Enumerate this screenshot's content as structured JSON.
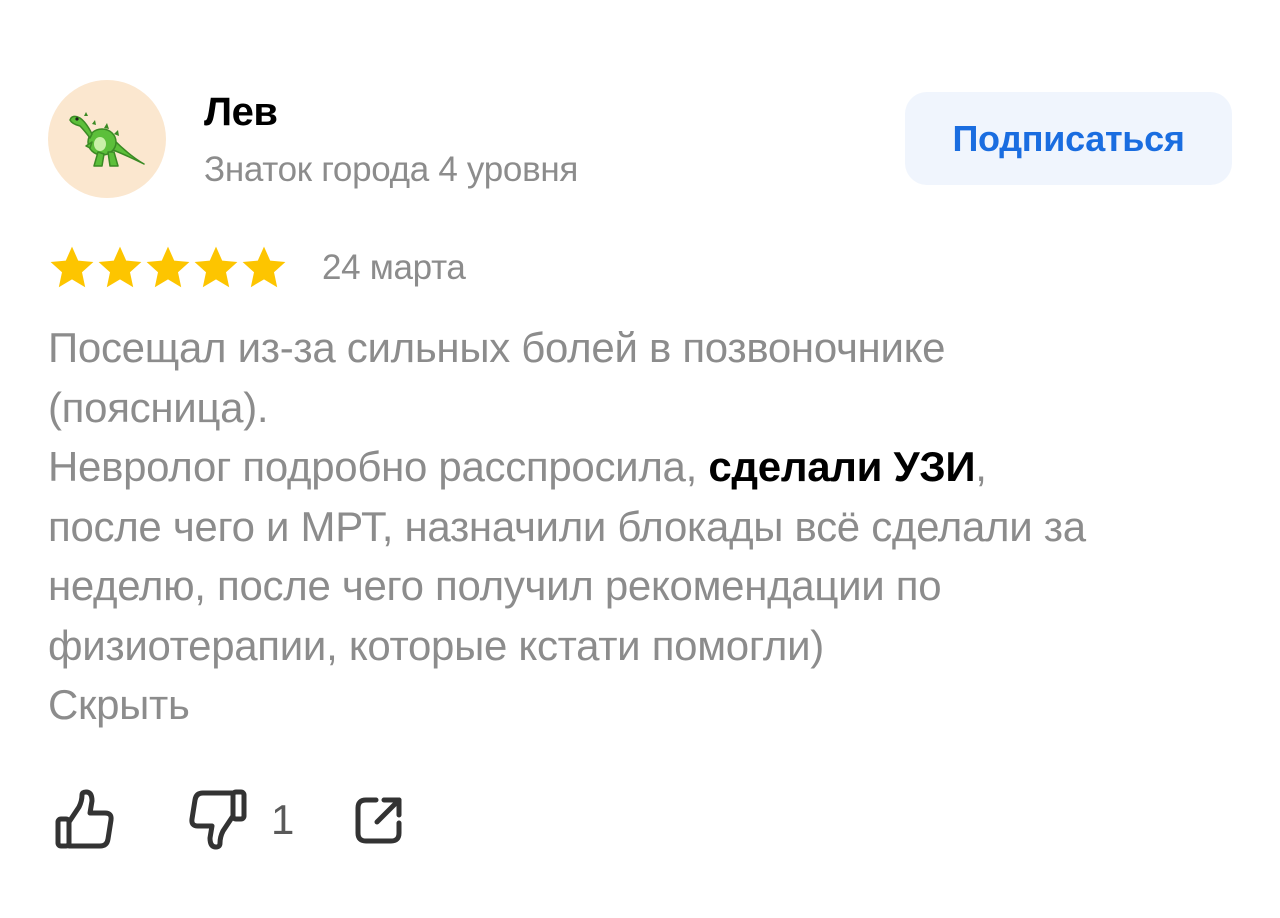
{
  "author": {
    "name": "Лев",
    "level": "Знаток города 4 уровня",
    "avatar_icon": "t-rex-icon"
  },
  "subscribe_label": "Подписаться",
  "rating": {
    "stars": 5,
    "max_stars": 5,
    "star_color": "#fdc500"
  },
  "date": "24 марта",
  "review": {
    "line1": "Посещал из-за сильных болей в позвоночнике",
    "line2": "(поясница).",
    "line3_before": "Невролог подробно расспросила, ",
    "line3_highlight": "сделали УЗИ",
    "line3_after": ",",
    "line4": "после чего и МРТ, назначили блокады всё сделали за",
    "line5": "неделю, после чего получил рекомендации по",
    "line6": "физиотерапии, которые кстати помогли)"
  },
  "collapse_label": "Скрыть",
  "actions": {
    "like_icon": "thumbs-up-icon",
    "dislike_icon": "thumbs-down-icon",
    "dislike_count": "1",
    "share_icon": "share-icon"
  },
  "colors": {
    "accent": "#1a6de0",
    "button_bg": "#f0f5fd",
    "secondary_text": "#8c8c8c",
    "avatar_bg": "#fbe7cf"
  }
}
